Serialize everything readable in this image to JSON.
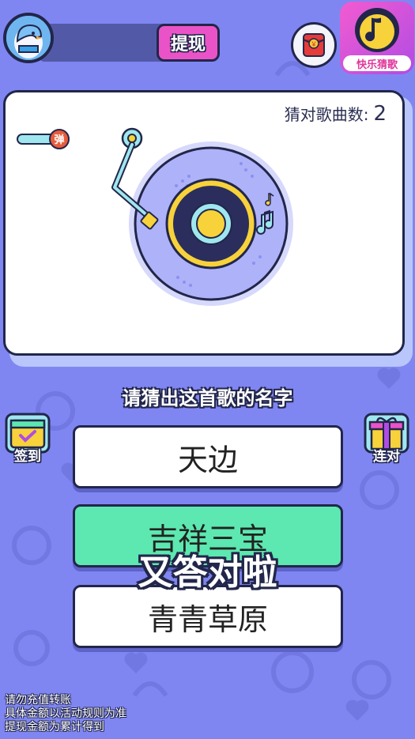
{
  "header": {
    "withdraw_label": "提现",
    "app_logo_label": "快乐猜歌",
    "redpacket_symbol": "￥"
  },
  "card": {
    "score_label": "猜对歌曲数:",
    "score_value": "2",
    "danmu_label": "弹"
  },
  "question": "请猜出这首歌的名字",
  "side": {
    "checkin_label": "签到",
    "streak_label": "连对"
  },
  "options": [
    {
      "label": "天边",
      "state": "normal"
    },
    {
      "label": "吉祥三宝",
      "state": "selected"
    },
    {
      "label": "青青草原",
      "state": "normal"
    }
  ],
  "overlay": "又答对啦",
  "notice": [
    "请勿充值转账",
    "具体金额以活动规则为准",
    "提现金额为累计得到"
  ],
  "colors": {
    "background": "#7f86f2",
    "outline": "#22264a",
    "accent_pink": "#ea53c8",
    "correct_green": "#5ce8b0"
  }
}
